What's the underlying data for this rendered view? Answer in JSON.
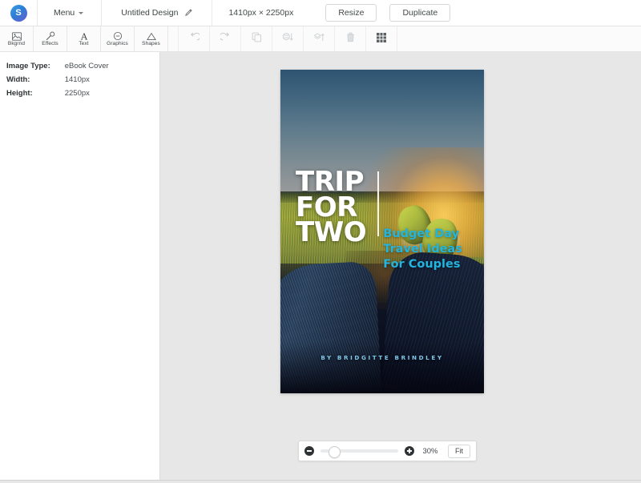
{
  "header": {
    "logo_letter": "S",
    "menu_label": "Menu",
    "design_title": "Untitled Design",
    "dimensions_label": "1410px × 2250px",
    "resize_label": "Resize",
    "duplicate_label": "Duplicate",
    "edit_icon": "pencil-icon",
    "caret_icon": "chevron-down-icon"
  },
  "toolbar": {
    "tabs": [
      {
        "label": "Bkgrnd",
        "icon": "background-image-icon"
      },
      {
        "label": "Effects",
        "icon": "magic-wand-icon"
      },
      {
        "label": "Text",
        "icon": "text-a-icon"
      },
      {
        "label": "Graphics",
        "icon": "graphics-circle-icon"
      },
      {
        "label": "Shapes",
        "icon": "triangle-shape-icon"
      }
    ],
    "actions": [
      {
        "name": "undo",
        "icon": "undo-arrow-icon"
      },
      {
        "name": "redo",
        "icon": "redo-arrow-icon"
      },
      {
        "name": "duplicate-layer",
        "icon": "copy-icon"
      },
      {
        "name": "send-backward",
        "icon": "layer-down-icon"
      },
      {
        "name": "bring-forward",
        "icon": "layer-up-icon"
      },
      {
        "name": "delete",
        "icon": "trash-icon"
      },
      {
        "name": "grid",
        "icon": "grid-icon"
      }
    ]
  },
  "left_panel": {
    "rows": [
      {
        "key": "Image Type:",
        "value": "eBook Cover"
      },
      {
        "key": "Width:",
        "value": "1410px"
      },
      {
        "key": "Height:",
        "value": "2250px"
      }
    ]
  },
  "cover": {
    "title_line1": "TRIP",
    "title_line2": "FOR",
    "title_line3": "TWO",
    "subtitle_line1": "Budget Day",
    "subtitle_line2": "Travel Ideas",
    "subtitle_line3": "For Couples",
    "byline": "BY BRIDGITTE BRINDLEY",
    "title_color": "#ffffff",
    "subtitle_color": "#21b5e0",
    "byline_color": "#7fc8ea"
  },
  "zoom_bar": {
    "zoom_out_icon": "minus-circle-icon",
    "zoom_in_icon": "plus-circle-icon",
    "percent": "30%",
    "fit_label": "Fit"
  },
  "colors": {
    "canvas_bg": "#e7e7e7",
    "panel_bg": "#ffffff",
    "border": "#e3e3e3",
    "accent": "#21b5e0"
  }
}
